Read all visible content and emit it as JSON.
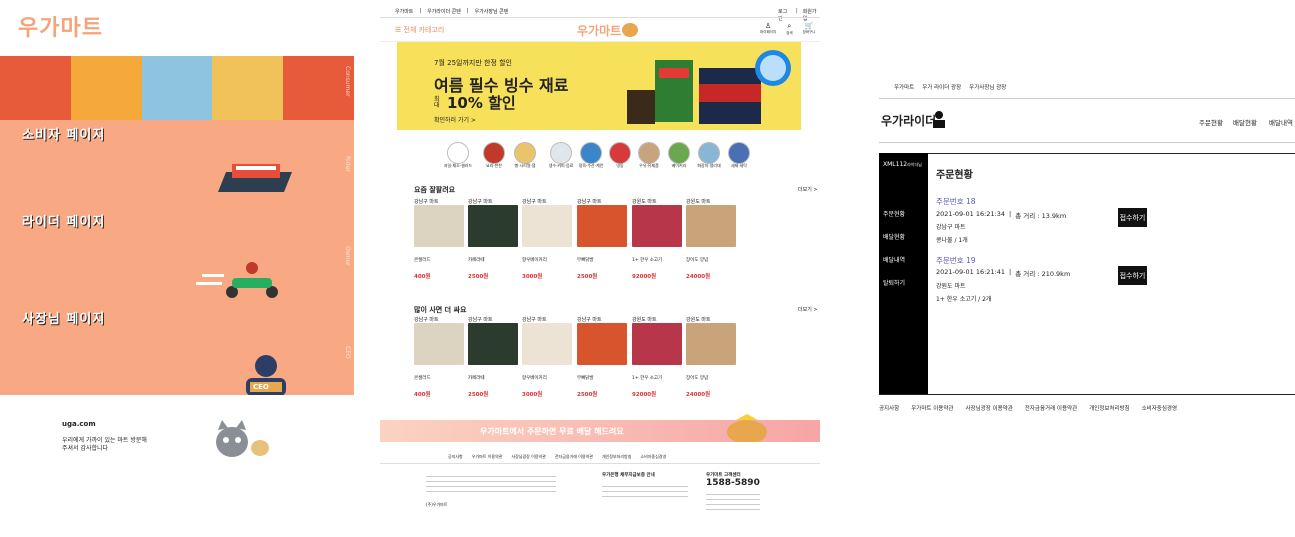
{
  "panel1": {
    "logo": "우가마트",
    "menu": [
      "소비자 페이지",
      "라이더 페이지",
      "사장님 페이지"
    ],
    "ceo_label": "CEO",
    "footer_site": "uga.com",
    "footer_msg": "우리에게 가까이 있는 마트 방문해 주셔서 감사합니다"
  },
  "panel2": {
    "top_links": [
      "우가마트",
      "우가라이더 콘텐",
      "우가사장님 콘텐"
    ],
    "top_right": [
      "로그인",
      "회원가입"
    ],
    "category_btn": "☰ 전체 카테고리",
    "logo": "우가마트",
    "header_icons": [
      "마이페이지",
      "검색",
      "장바구니"
    ],
    "banner_sub": "7월 25일까지만 한정 할인",
    "banner_title": "여름 필수 빙수 재료",
    "banner_max": "최대",
    "banner_pct": "10% 할인",
    "banner_cta": "확인하러 가기 >",
    "categories": [
      "과일·채소·샐러드",
      "요리·반찬",
      "빵·시리얼·잼",
      "생수·커피·음료",
      "정육·수산·계란",
      "냉동",
      "우유·유제품",
      "베이커리",
      "화장지·생리대",
      "세제·세탁"
    ],
    "section1": "요즘 잘팔려요",
    "section2": "많이 사면 더 싸요",
    "more": "더보기 >",
    "products": [
      {
        "store": "강남구 마트",
        "name": "콘샐러드",
        "price": "400원"
      },
      {
        "store": "강남구 마트",
        "name": "카페라떼",
        "price": "2500원"
      },
      {
        "store": "강남구 마트",
        "name": "항우베이커리",
        "price": "3000원"
      },
      {
        "store": "강남구 마트",
        "name": "무뼈닭발",
        "price": "2500원"
      },
      {
        "store": "강원도 마트",
        "name": "1+ 한우 소고기",
        "price": "92000원"
      },
      {
        "store": "강원도 마트",
        "name": "장어도 양념",
        "price": "24000원"
      }
    ],
    "promo": "우가마트에서 주문하면 무료 배달 해드려요",
    "footer_links": [
      "공지사항",
      "우가마트 이용약관",
      "사장님광장 이용약관",
      "전자금융거래 이용약관",
      "개인정보처리방침",
      "소비자중심경영"
    ],
    "company": "(주)우가마트",
    "protect_title": "우가은행 채무지급보증 안내",
    "cs_title": "우가마트 고객센터",
    "cs_phone": "1588-5890"
  },
  "panel3": {
    "top_links": [
      "우가마트",
      "우가 라이더 광장",
      "우가사장님 광장"
    ],
    "logo": "우가라이더",
    "nav": [
      "주문현황",
      "배달현황",
      "배달내역"
    ],
    "rider_id": "XML112",
    "rider_suffix": "라이더님",
    "side_menu": [
      "주문현황",
      "배달현황",
      "배달내역",
      "탈퇴하기"
    ],
    "heading": "주문현황",
    "orders": [
      {
        "num": "주문번호 18",
        "time": "2021-09-01 16:21:34",
        "dist": "총 거리 : 13.9km",
        "store": "강남구 마트",
        "item": "콩나물 / 1개",
        "btn": "접수하기"
      },
      {
        "num": "주문번호 19",
        "time": "2021-09-01 16:21:41",
        "dist": "총 거리 : 210.9km",
        "store": "강원도 마트",
        "item": "1+ 한우 소고기 / 2개",
        "btn": "접수하기"
      }
    ],
    "footer": [
      "공지사항",
      "우가마트 이용약관",
      "사장님광장 이용약관",
      "전자금융거래 이용약관",
      "개인정보처리방침",
      "소비자중심경영"
    ]
  }
}
